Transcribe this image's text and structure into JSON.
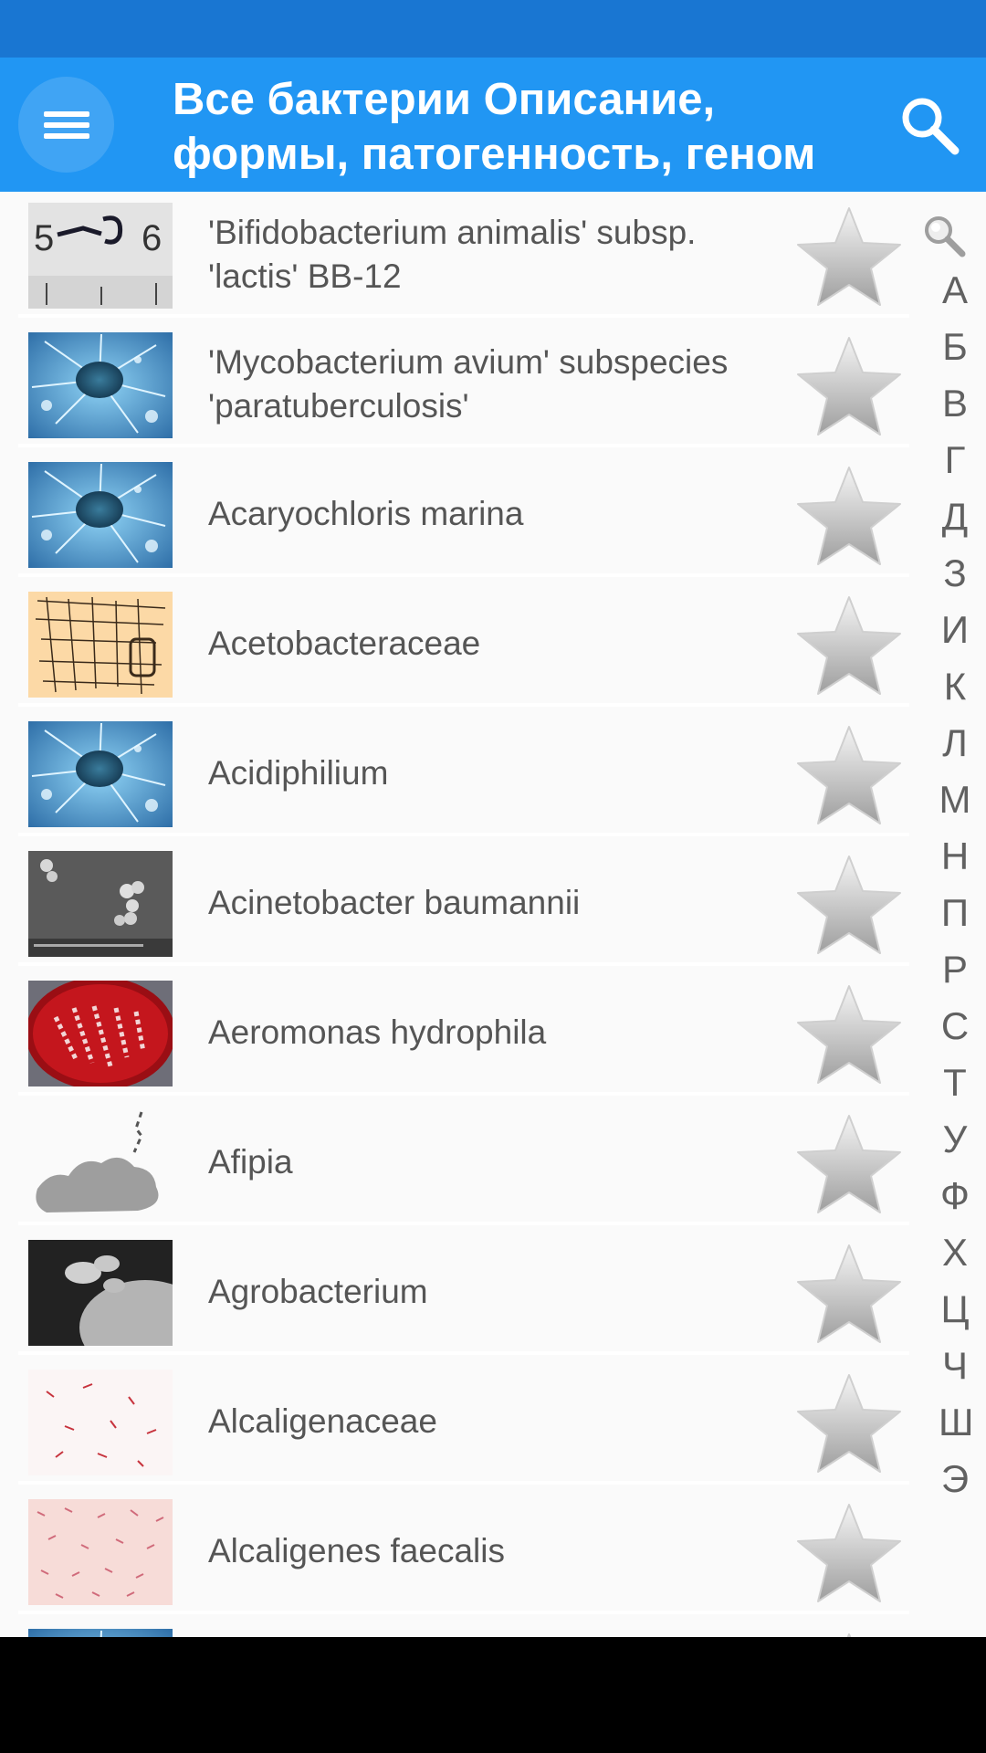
{
  "app_bar": {
    "title": "Все бактерии Описание, формы, патогенность, геном",
    "menu_icon": "menu-icon",
    "search_icon": "search-icon",
    "color": "#2196f3",
    "status_color": "#1976d2"
  },
  "list": {
    "items": [
      {
        "label": "'Bifidobacterium animalis' subsp. 'lactis' BB-12",
        "thumb": "ruler-photo"
      },
      {
        "label": "'Mycobacterium avium' subspecies 'paratuberculosis'",
        "thumb": "blue-cell"
      },
      {
        "label": "Acaryochloris marina",
        "thumb": "blue-cell"
      },
      {
        "label": "Acetobacteraceae",
        "thumb": "sketch-drawing"
      },
      {
        "label": "Acidiphilium",
        "thumb": "blue-cell"
      },
      {
        "label": "Acinetobacter baumannii",
        "thumb": "sem-micrograph"
      },
      {
        "label": "Aeromonas hydrophila",
        "thumb": "petri-dish"
      },
      {
        "label": "Afipia",
        "thumb": "gray-blob"
      },
      {
        "label": "Agrobacterium",
        "thumb": "dark-micrograph"
      },
      {
        "label": "Alcaligenaceae",
        "thumb": "stain-light"
      },
      {
        "label": "Alcaligenes faecalis",
        "thumb": "stain-pink"
      },
      {
        "label": "",
        "thumb": "blue-cell"
      }
    ],
    "favorite_icon": "star-icon"
  },
  "index": {
    "search_icon": "magnifier-icon",
    "letters": [
      "А",
      "Б",
      "В",
      "Г",
      "Д",
      "З",
      "И",
      "К",
      "Л",
      "М",
      "Н",
      "П",
      "Р",
      "С",
      "Т",
      "У",
      "Ф",
      "Х",
      "Ц",
      "Ч",
      "Ш",
      "Э"
    ]
  }
}
